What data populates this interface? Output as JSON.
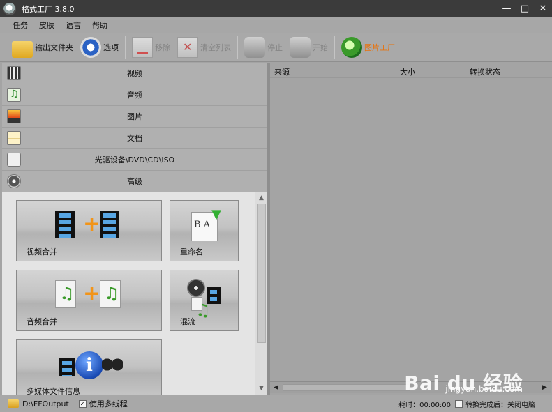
{
  "window": {
    "title": "格式工厂 3.8.0",
    "controls": {
      "minimize": "—",
      "maximize": "□",
      "close": "✕"
    }
  },
  "menu": [
    "任务",
    "皮肤",
    "语言",
    "帮助"
  ],
  "toolbar": {
    "output_folder": "输出文件夹",
    "options": "选项",
    "remove": "移除",
    "clear_list": "清空列表",
    "stop": "停止",
    "start": "开始",
    "image_factory": "图片工厂"
  },
  "categories": [
    {
      "label": "视频",
      "icon": "film-icon"
    },
    {
      "label": "音频",
      "icon": "music-note-icon"
    },
    {
      "label": "图片",
      "icon": "picture-icon"
    },
    {
      "label": "文档",
      "icon": "document-icon"
    },
    {
      "label": "光驱设备\\DVD\\CD\\ISO",
      "icon": "optical-drive-icon"
    },
    {
      "label": "高级",
      "icon": "film-reel-icon"
    }
  ],
  "tools": [
    {
      "label": "视频合并",
      "icon": "video-join-icon"
    },
    {
      "label": "重命名",
      "icon": "rename-icon"
    },
    {
      "label": "音频合并",
      "icon": "audio-join-icon"
    },
    {
      "label": "混流",
      "icon": "mux-icon"
    },
    {
      "label": "多媒体文件信息",
      "icon": "media-info-icon"
    }
  ],
  "task_list": {
    "columns": [
      "来源",
      "大小",
      "转换状态"
    ]
  },
  "watermark": {
    "main": "Bai du 经验",
    "sub": "jingyan.baidu.com"
  },
  "status": {
    "output_path": "D:\\FFOutput",
    "multithread_label": "使用多线程",
    "multithread_checked": "✓",
    "elapsed": "耗时：00:00:00",
    "after_done": "转换完成后：关闭电脑"
  }
}
